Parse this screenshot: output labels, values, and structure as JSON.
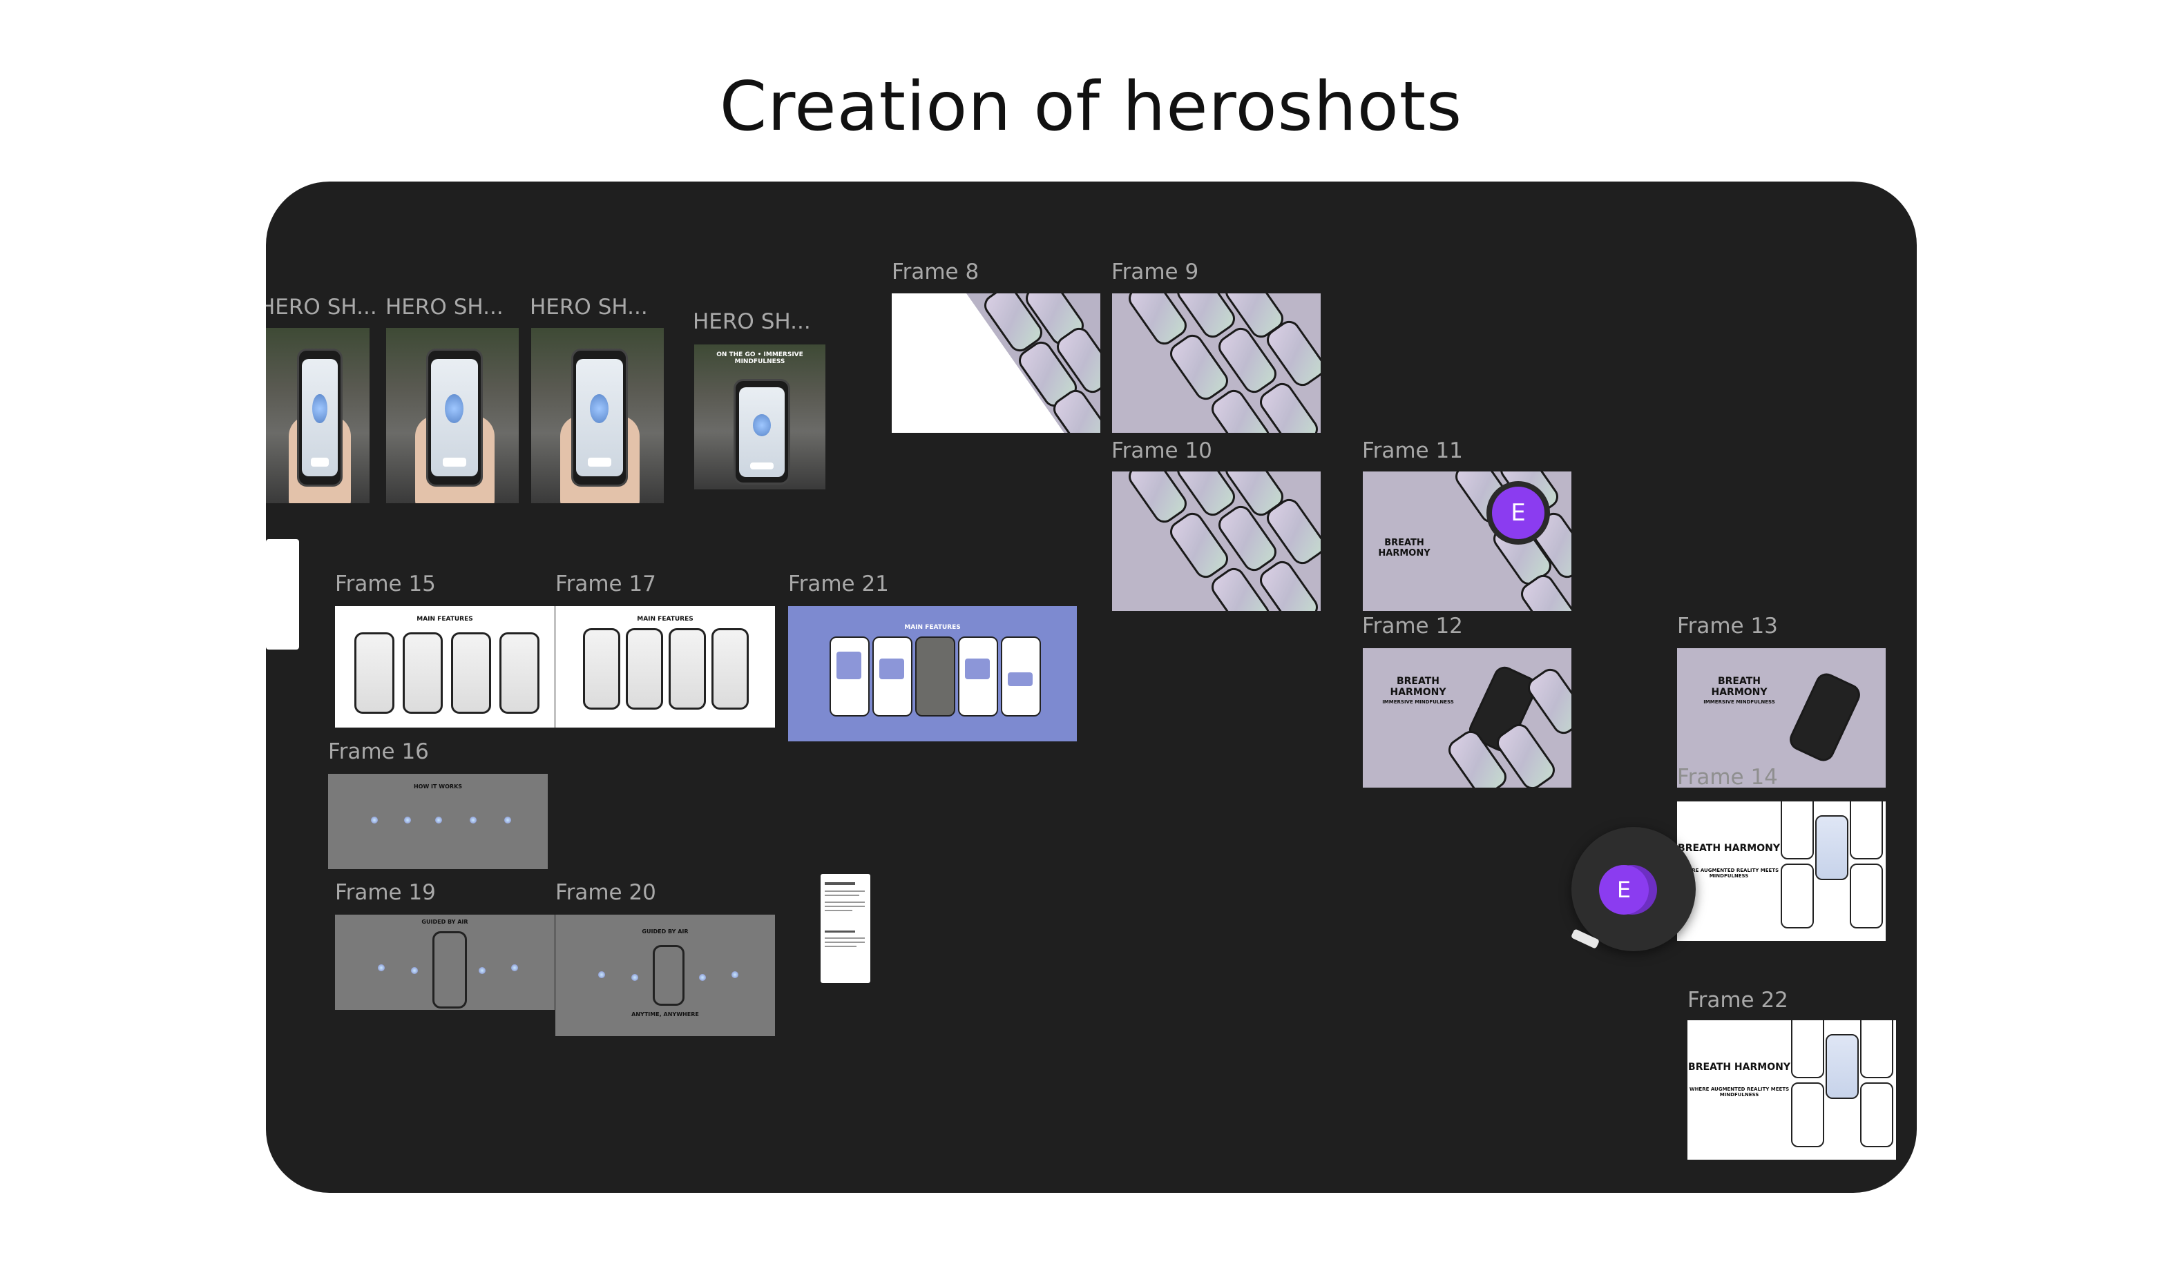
{
  "page": {
    "title": "Creation of heroshots"
  },
  "avatar_initial": "E",
  "frames": {
    "hero1": "HERO SH...",
    "hero2": "HERO SH...",
    "hero3": "HERO SH...",
    "hero4": "HERO SH...",
    "f8": "Frame 8",
    "f9": "Frame 9",
    "f10": "Frame 10",
    "f11": "Frame 11",
    "f12": "Frame 12",
    "f13": "Frame 13",
    "f14": "Frame 14",
    "f15": "Frame 15",
    "f16": "Frame 16",
    "f17": "Frame 17",
    "f19": "Frame 19",
    "f20": "Frame 20",
    "f21": "Frame 21",
    "f22": "Frame 22"
  },
  "captions": {
    "on_the_go": "ON THE GO • IMMERSIVE MINDFULNESS",
    "main_features": "MAIN FEATURES",
    "how_it_works": "HOW IT WORKS",
    "guided_by_air": "GUIDED BY AIR",
    "anytime": "ANYTIME, ANYWHERE",
    "breath_harmony": "BREATH HARMONY",
    "immersive": "IMMERSIVE MINDFULNESS",
    "augmented": "WHERE AUGMENTED REALITY MEETS MINDFULNESS"
  },
  "colors": {
    "canvas": "#1f1f1f",
    "frame_label": "#a9a9a9",
    "avatar": "#8b3cf0",
    "lavender": "#bcb6c8",
    "periwinkle": "#7d8ad0",
    "grey_frame": "#7a7a7a"
  }
}
